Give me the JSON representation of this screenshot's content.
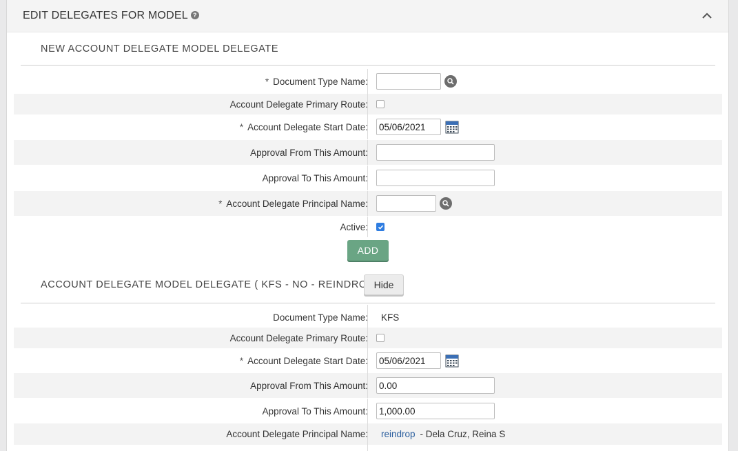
{
  "panel": {
    "title": "EDIT DELEGATES FOR MODEL",
    "help_icon": "?"
  },
  "new_section": {
    "title": "NEW ACCOUNT DELEGATE MODEL DELEGATE",
    "required_mark": "*",
    "fields": {
      "doc_type_label": "Document Type Name:",
      "doc_type_value": "",
      "primary_route_label": "Account Delegate Primary Route:",
      "primary_route_checked": false,
      "start_date_label": "Account Delegate Start Date:",
      "start_date_value": "05/06/2021",
      "approval_from_label": "Approval From This Amount:",
      "approval_from_value": "",
      "approval_to_label": "Approval To This Amount:",
      "approval_to_value": "",
      "principal_label": "Account Delegate Principal Name:",
      "principal_value": "",
      "active_label": "Active:",
      "active_checked": true
    },
    "add_button": "ADD"
  },
  "existing_section": {
    "title": "ACCOUNT DELEGATE MODEL DELEGATE ( KFS - NO - REINDROP )",
    "hide_button": "Hide",
    "fields": {
      "doc_type_label": "Document Type Name:",
      "doc_type_value": "KFS",
      "primary_route_label": "Account Delegate Primary Route:",
      "primary_route_checked": false,
      "start_date_label": "Account Delegate Start Date:",
      "start_date_value": "05/06/2021",
      "approval_from_label": "Approval From This Amount:",
      "approval_from_value": "0.00",
      "approval_to_label": "Approval To This Amount:",
      "approval_to_value": "1,000.00",
      "principal_label": "Account Delegate Principal Name:",
      "principal_link": "reindrop",
      "principal_name": "- Dela Cruz, Reina S"
    }
  },
  "colors": {
    "add_button": "#6aa584",
    "link": "#2a5e9e",
    "checkbox_checked": "#2f7de1"
  },
  "icons": {
    "help": "help-icon",
    "collapse": "chevron-up-icon",
    "lookup": "search-icon",
    "calendar": "calendar-icon"
  }
}
